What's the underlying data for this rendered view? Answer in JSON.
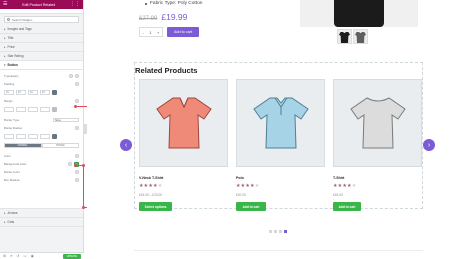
{
  "panel": {
    "header_title": "Edit Product Related",
    "search_placeholder": "Search Widget...",
    "sections_top": [
      {
        "label": "Images and Tags"
      },
      {
        "label": "Title"
      },
      {
        "label": "Price"
      },
      {
        "label": "Star Rating"
      }
    ],
    "buttons_section": {
      "label": "Button",
      "controls": {
        "typography": "Typography",
        "padding": "Padding",
        "margin": "Margin",
        "border_type": "Border Type",
        "border_type_value": "None",
        "border_radius": "Border Radius",
        "state_normal": "NORMAL",
        "state_hover": "HOVER",
        "color": "Color",
        "background_color": "Background Color",
        "border_color": "Border Color",
        "box_shadow": "Box Shadow"
      }
    },
    "sections_bottom": [
      {
        "label": "Arrows"
      },
      {
        "label": "Dots"
      }
    ],
    "update_label": "UPDATE",
    "accent_color": "#9b0a56",
    "update_color": "#39b54a"
  },
  "product": {
    "bullet": "Fabric Type: Poly Cotton",
    "old_price": "£27.99",
    "new_price": "£19.99",
    "qty_minus": "-",
    "qty_value": "1",
    "qty_plus": "+",
    "add_to_cart": "Add to cart",
    "accent_color": "#7b5cd6"
  },
  "related": {
    "title": "Related Products",
    "prev_icon": "chevron-left-icon",
    "next_icon": "chevron-right-icon",
    "products": [
      {
        "name": "V-Neck T-Shirt",
        "rating_stars": 4,
        "price": "£15.00 – £20.00",
        "button": "Select options",
        "shirt_color": "#f08a78"
      },
      {
        "name": "Polo",
        "rating_stars": 4,
        "price": "£20.00",
        "button": "Add to cart",
        "shirt_color": "#a7d3e6"
      },
      {
        "name": "T-Shirt",
        "rating_stars": 4,
        "price": "£18.00",
        "button": "Add to cart",
        "shirt_color": "#dcdcdc"
      }
    ],
    "star_glyph": "★",
    "button_color": "#39b54a",
    "dots_count": 4,
    "dots_active_index": 3
  }
}
